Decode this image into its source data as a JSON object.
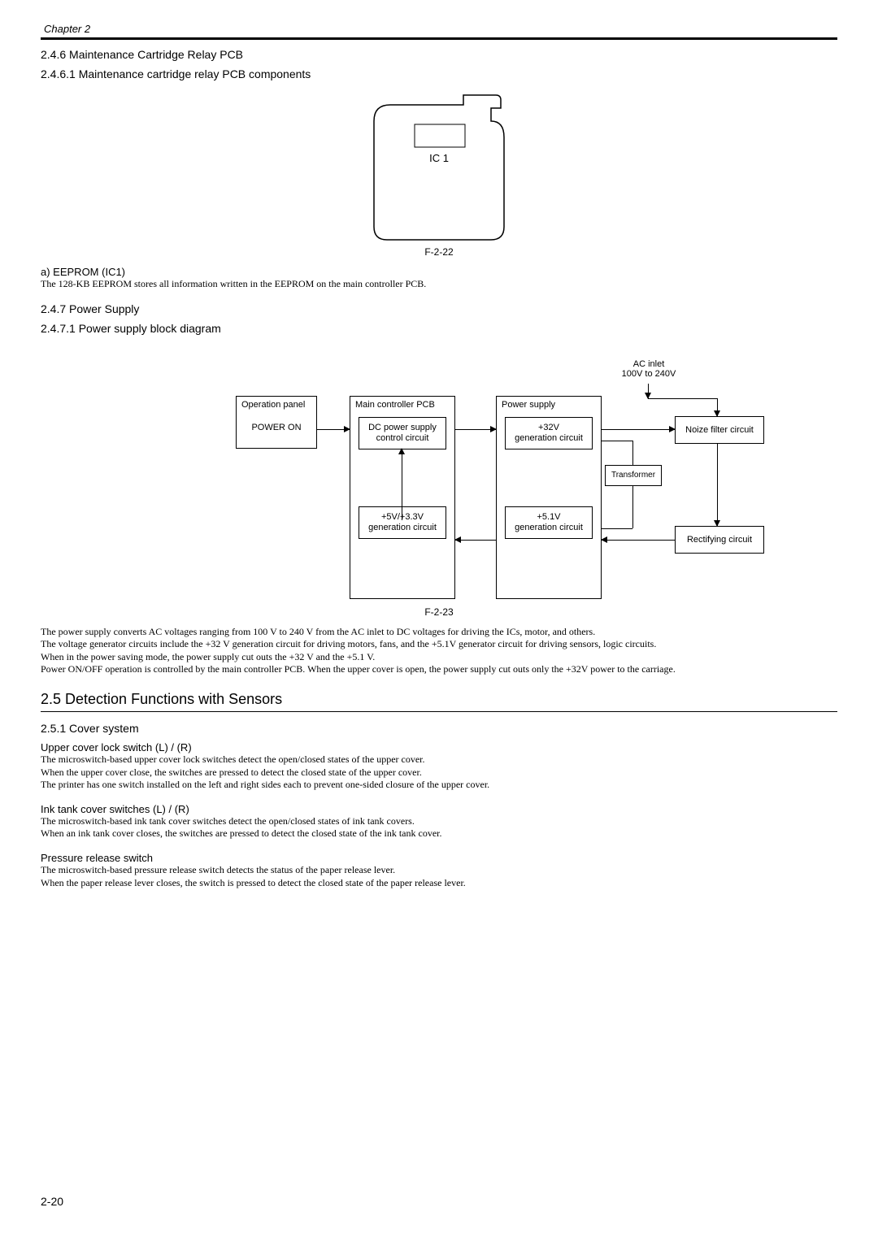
{
  "chapter": "Chapter 2",
  "s246": {
    "title": "2.4.6 Maintenance Cartridge Relay PCB",
    "sub1": "2.4.6.1 Maintenance cartridge relay PCB components",
    "ic_label": "IC 1",
    "fig": "F-2-22",
    "a_heading": "a) EEPROM (IC1)",
    "a_body": "The 128-KB EEPROM stores all information written in the EEPROM on the main controller PCB."
  },
  "s247": {
    "title": "2.4.7 Power Supply",
    "sub1": "2.4.7.1 Power supply block diagram",
    "fig": "F-2-23",
    "diagram": {
      "ac_inlet_top": "AC inlet",
      "ac_inlet_bottom": "100V to 240V",
      "operation_panel": "Operation panel",
      "power_on": "POWER ON",
      "main_controller": "Main controller PCB",
      "dc_power": "DC power supply control circuit",
      "v5v33": "+5V/+3.3V generation circuit",
      "power_supply": "Power supply",
      "v32": "+32V generation circuit",
      "v51": "+5.1V generation circuit",
      "transformer": "Transformer",
      "noise_filter": "Noize filter circuit",
      "rectifying": "Rectifying circuit"
    },
    "body1": "The power supply converts AC voltages ranging from 100 V to 240 V from the AC inlet to DC voltages for driving the ICs, motor, and others.",
    "body2": "The voltage generator circuits include the +32 V generation circuit for driving motors, fans, and the +5.1V generator circuit for driving sensors, logic circuits.",
    "body3": "When in the power saving mode, the power supply cut outs the +32 V and the +5.1 V.",
    "body4": "Power ON/OFF operation is controlled by the main controller PCB. When the upper cover is open, the power supply cut outs only the +32V power to the carriage."
  },
  "s25": {
    "title": "2.5 Detection Functions with Sensors",
    "s251": "2.5.1 Cover system",
    "upper_h": "Upper cover lock switch (L) / (R)",
    "upper_1": "The microswitch-based upper cover lock switches detect the open/closed states of the upper cover.",
    "upper_2": "When the upper cover close, the switches are pressed to detect the closed state of the upper cover.",
    "upper_3": "The printer has one switch installed on the left and right sides each to prevent one-sided closure of the upper cover.",
    "ink_h": "Ink tank cover switches (L) / (R)",
    "ink_1": "The microswitch-based ink tank cover switches detect the open/closed states of ink tank covers.",
    "ink_2": "When an ink tank cover closes, the switches are pressed to detect the closed state of the ink tank cover.",
    "pressure_h": "Pressure release switch",
    "pressure_1": "The microswitch-based pressure release switch detects the status of the paper release lever.",
    "pressure_2": "When the paper release lever closes, the switch is pressed to detect the closed state of the paper release lever."
  },
  "pageNum": "2-20"
}
